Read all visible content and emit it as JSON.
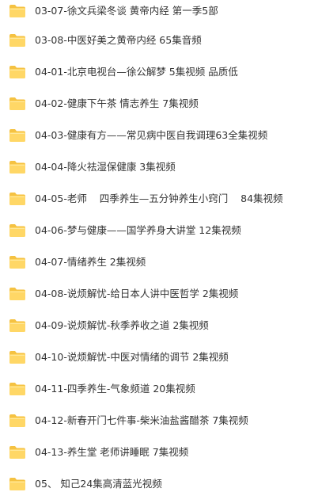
{
  "colors": {
    "folder_body": "#FFD766",
    "folder_tab": "#F5C242",
    "text": "#333333",
    "background": "#FFFFFF"
  },
  "folders": [
    {
      "icon": "folder-icon",
      "label": "03-07-徐文兵梁冬谈 黄帝内经 第一季5部"
    },
    {
      "icon": "folder-icon",
      "label": "03-08-中医好美之黄帝内经 65集音频"
    },
    {
      "icon": "folder-icon",
      "label": "04-01-北京电视台—徐公解梦 5集视频 品质低"
    },
    {
      "icon": "folder-icon",
      "label": "04-02-健康下午茶 情志养生 7集视频"
    },
    {
      "icon": "folder-icon",
      "label": "04-03-健康有方——常见病中医自我调理63全集视频"
    },
    {
      "icon": "folder-icon",
      "label": "04-04-降火祛湿保健康 3集视频"
    },
    {
      "icon": "folder-icon",
      "label": "04-05-老师    四季养生—五分钟养生小窍门    84集视频"
    },
    {
      "icon": "folder-icon",
      "label": "04-06-梦与健康——国学养身大讲堂 12集视频"
    },
    {
      "icon": "folder-icon",
      "label": "04-07-情绪养生 2集视频"
    },
    {
      "icon": "folder-icon",
      "label": "04-08-说烦解忧-给日本人讲中医哲学 2集视频"
    },
    {
      "icon": "folder-icon",
      "label": "04-09-说烦解忧-秋季养收之道 2集视频"
    },
    {
      "icon": "folder-icon",
      "label": "04-10-说烦解忧-中医对情绪的调节 2集视频"
    },
    {
      "icon": "folder-icon",
      "label": "04-11-四季养生-气象频道 20集视频"
    },
    {
      "icon": "folder-icon",
      "label": "04-12-新春开门七件事-柴米油盐酱醋茶 7集视频"
    },
    {
      "icon": "folder-icon",
      "label": "04-13-养生堂 老师讲睡眠 7集视频"
    },
    {
      "icon": "folder-icon",
      "label": "05、 知己24集高清蓝光视频"
    }
  ]
}
